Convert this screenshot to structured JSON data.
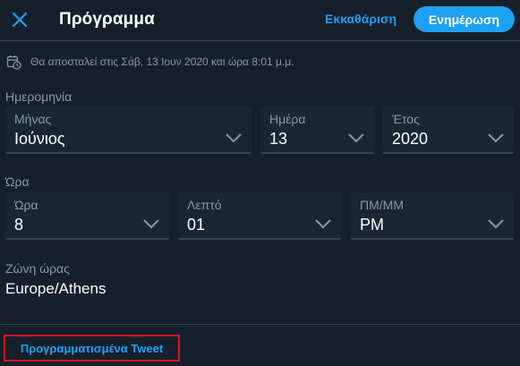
{
  "header": {
    "title": "Πρόγραμμα",
    "clear_label": "Εκκαθάριση",
    "update_label": "Ενημέρωση",
    "close_icon": "close-icon"
  },
  "notice": {
    "icon": "calendar-clock-icon",
    "text": "Θα αποσταλεί στις Σάβ, 13 Ιουν 2020 και ώρα 8:01 μ.μ."
  },
  "date_section": {
    "label": "Ημερομηνία",
    "month": {
      "label": "Μήνας",
      "value": "Ιούνιος"
    },
    "day": {
      "label": "Ημέρα",
      "value": "13"
    },
    "year": {
      "label": "Έτος",
      "value": "2020"
    }
  },
  "time_section": {
    "label": "Ώρα",
    "hour": {
      "label": "Ώρα",
      "value": "8"
    },
    "minute": {
      "label": "Λεπτό",
      "value": "01"
    },
    "ampm": {
      "label": "ΠΜ/ΜΜ",
      "value": "PM"
    }
  },
  "timezone": {
    "label": "Ζώνη ώρας",
    "value": "Europe/Athens"
  },
  "footer": {
    "scheduled_link": "Προγραμματισμένα Tweet"
  },
  "colors": {
    "background": "#15202b",
    "field_background": "#192734",
    "accent": "#1da1f2",
    "muted_text": "#8899a6",
    "highlight_border": "#e0141e"
  }
}
